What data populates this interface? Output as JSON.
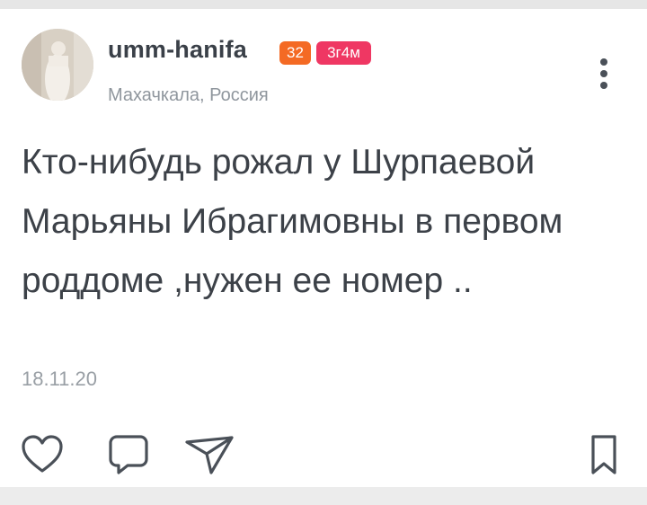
{
  "post": {
    "author": {
      "username": "umm-hanifa",
      "level_badge": "32",
      "time_badge": "3г4м",
      "location": "Махачкала, Россия"
    },
    "text": "Кто-нибудь рожал у Шурпаевой Марьяны Ибрагимовны в первом роддоме ,нужен ее номер ..",
    "date": "18.11.20"
  },
  "icons": {
    "more": "more-vertical-icon",
    "like": "heart-icon",
    "comment": "comment-icon",
    "share": "send-icon",
    "bookmark": "bookmark-icon"
  },
  "colors": {
    "level_badge": "#f46a24",
    "time_badge": "#ef3763",
    "icon": "#4a5058"
  }
}
